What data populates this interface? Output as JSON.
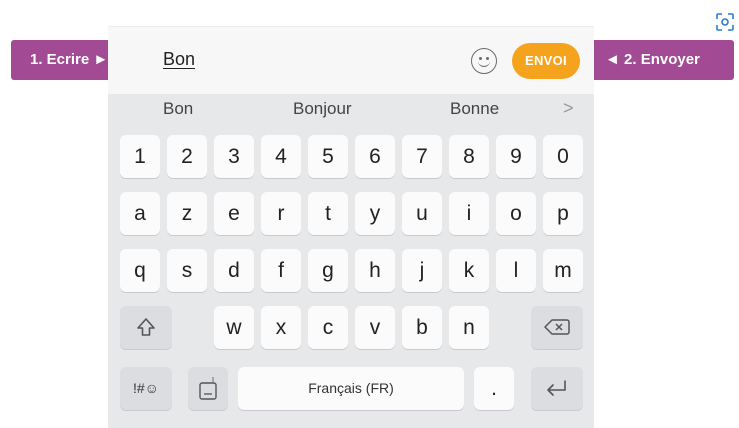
{
  "annotations": {
    "left_callout": "1. Ecrire ►",
    "right_callout": "◄ 2. Envoyer"
  },
  "input": {
    "typed_text": "Bon",
    "send_label": "ENVOI",
    "emoji_icon": "smiley-icon"
  },
  "suggestions": {
    "items": [
      "Bon",
      "Bonjour",
      "Bonne"
    ],
    "more_icon": "chevron-right-icon"
  },
  "keyboard": {
    "row_numbers": [
      "1",
      "2",
      "3",
      "4",
      "5",
      "6",
      "7",
      "8",
      "9",
      "0"
    ],
    "row1": [
      "a",
      "z",
      "e",
      "r",
      "t",
      "y",
      "u",
      "i",
      "o",
      "p"
    ],
    "row2": [
      "q",
      "s",
      "d",
      "f",
      "g",
      "h",
      "j",
      "k",
      "l",
      "m"
    ],
    "row3": [
      "w",
      "x",
      "c",
      "v",
      "b",
      "n"
    ],
    "symbols_label": "!#☺",
    "space_label": "Français (FR)",
    "period_label": ".",
    "shift_icon": "shift-icon",
    "backspace_icon": "backspace-icon",
    "settings_icon": "keyboard-settings-icon",
    "enter_icon": "enter-icon"
  },
  "colors": {
    "callout": "#a24a93",
    "send_button": "#f5a31d",
    "keyboard_bg": "#e7e8ea"
  }
}
